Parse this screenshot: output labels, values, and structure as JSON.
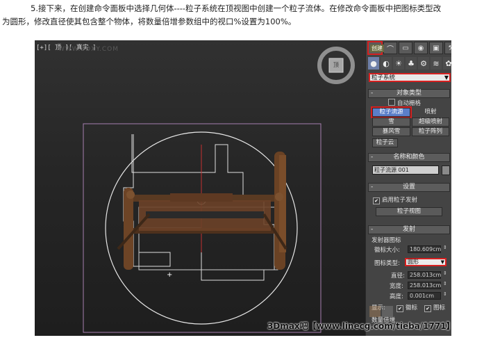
{
  "instruction": {
    "line1": "5.接下来，在创建命令面板中选择几何体----粒子系统在顶视图中创建一个粒子流体。在修改命令面板中把图标类型改",
    "line2": "为圆形，修改直径使其包含整个物体，将数量倍增参数组中的视口%设置为100%。"
  },
  "viewport": {
    "label": "[+][ 顶 ][ 真实 ]",
    "watermark": "WWW.3DXY.COM",
    "navcube_label": "顶"
  },
  "command_panel": {
    "tab_tooltip": "创建",
    "tabs": [
      "✳",
      "⌒",
      "▭",
      "◉",
      "▣",
      "⚒"
    ],
    "category_icons": [
      "●",
      "◐",
      "☀",
      "♣",
      "⚙",
      "≋",
      "✿"
    ],
    "category_dropdown": "粒子系统",
    "object_type": {
      "title": "对象类型",
      "auto_grid": "自动栅格",
      "buttons": [
        "粒子流源",
        "喷射",
        "雪",
        "超级喷射",
        "暴风雪",
        "粒子阵列",
        "粒子云"
      ]
    },
    "name_color": {
      "title": "名称和颜色",
      "name_value": "粒子流源 001"
    },
    "setup": {
      "title": "设置",
      "enable_emission": "启用粒子发射",
      "particle_view": "粒子视图"
    },
    "emission": {
      "title": "发射",
      "emitter_icon_group": "发射器图标",
      "logo_size_label": "徽标大小:",
      "logo_size_value": "180.609cm",
      "icon_type_label": "图标类型:",
      "icon_type_value": "圆形",
      "diameter_label": "直径:",
      "diameter_value": "258.013cm",
      "width_label": "宽度:",
      "width_value": "258.013cm",
      "height_label": "高度:",
      "height_value": "0.001cm",
      "display_label": "显示:",
      "display_logo": "徽标",
      "display_icon": "图标",
      "quantity_multiplier": "数量倍增"
    }
  },
  "footer_watermark": "3Dmax吧【www.linecg.com/tieba/1771】"
}
